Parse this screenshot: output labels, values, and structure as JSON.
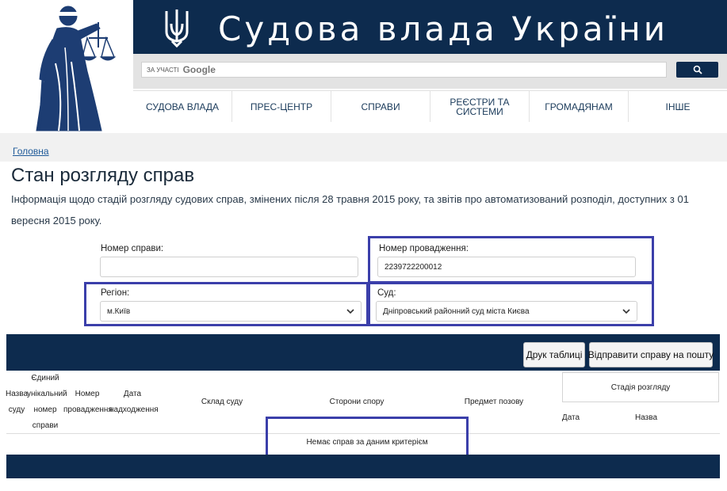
{
  "header": {
    "site_title": "Судова влада України",
    "search_prefix": "ЗА УЧАСТІ",
    "search_brand": "Google"
  },
  "nav": {
    "items": [
      {
        "label": "СУДОВА ВЛАДА"
      },
      {
        "label": "ПРЕС-ЦЕНТР"
      },
      {
        "label": "СПРАВИ"
      },
      {
        "label": "РЕЄСТРИ ТА СИСТЕМИ"
      },
      {
        "label": "ГРОМАДЯНАМ"
      },
      {
        "label": "ІНШЕ"
      }
    ]
  },
  "breadcrumb": "Головна",
  "page": {
    "title": "Стан розгляду справ",
    "info": "Інформація щодо стадій розгляду судових справ, змінених після 28 травня 2015 року, та звітів про автоматизований розподіл, доступних з 01 вересня 2015 року."
  },
  "form": {
    "case_number_label": "Номер справи:",
    "case_number_value": "",
    "proceeding_number_label": "Номер провадження:",
    "proceeding_number_value": "2239722200012",
    "region_label": "Регіон:",
    "region_value": "м.Київ",
    "court_label": "Суд:",
    "court_value": "Дніпровський районний суд міста Києва"
  },
  "buttons": {
    "print_label": "Друк таблиці",
    "send_label": "Відправити справу на пошту"
  },
  "table": {
    "col_name": [
      "Назва",
      "суду"
    ],
    "col_unique": [
      "Єдиний",
      "унікальний",
      "номер",
      "справи"
    ],
    "col_proceeding": [
      "Номер",
      "провадження"
    ],
    "col_received": [
      "Дата",
      "надходження"
    ],
    "col_composition": "Склад суду",
    "col_parties": "Сторони спору",
    "col_subject": "Предмет позову",
    "col_stage": "Стадія розгляду",
    "col_stage_date": "Дата",
    "col_stage_name": "Назва",
    "empty_message": "Немає справ за даним критерієм"
  },
  "colors": {
    "navy": "#0d2b4e",
    "highlight": "#3b3faa",
    "link": "#1f5a99"
  },
  "icons": [
    "themis-logo",
    "trident-icon",
    "search-icon",
    "chevron-down-icon"
  ]
}
